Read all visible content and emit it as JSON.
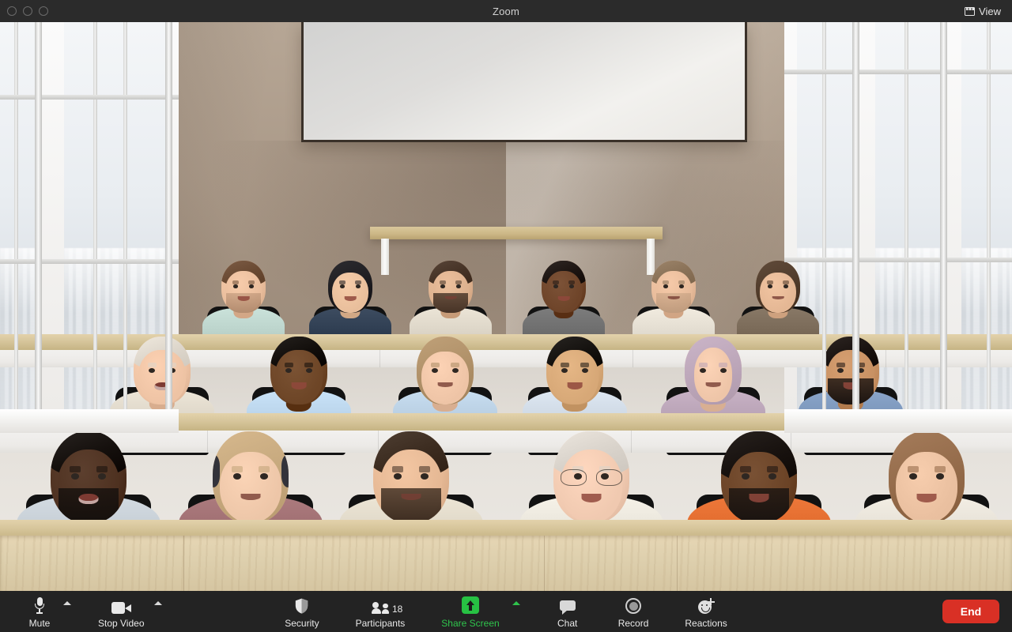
{
  "window": {
    "title": "Zoom",
    "traffic_lights": [
      "close",
      "minimize",
      "maximize"
    ]
  },
  "header": {
    "view_button_label": "View",
    "view_icon": "layout-grid-icon"
  },
  "meeting": {
    "participant_count": "18",
    "virtual_background": "conference-room-with-tiered-desks-and-city-windows",
    "layout": "immersive-view"
  },
  "toolbar": {
    "background_color": "#232323",
    "items": [
      {
        "id": "mute",
        "label": "Mute",
        "icon": "microphone-icon",
        "caret": true,
        "accent": false
      },
      {
        "id": "stop-video",
        "label": "Stop Video",
        "icon": "video-camera-icon",
        "caret": true,
        "accent": false
      },
      {
        "id": "security",
        "label": "Security",
        "icon": "shield-icon",
        "caret": false,
        "accent": false
      },
      {
        "id": "participants",
        "label": "Participants",
        "icon": "people-icon",
        "caret": false,
        "accent": false,
        "badge": "18"
      },
      {
        "id": "share-screen",
        "label": "Share Screen",
        "icon": "share-screen-icon",
        "caret": true,
        "accent": true
      },
      {
        "id": "chat",
        "label": "Chat",
        "icon": "chat-bubble-icon",
        "caret": false,
        "accent": false
      },
      {
        "id": "record",
        "label": "Record",
        "icon": "record-circle-icon",
        "caret": false,
        "accent": false
      },
      {
        "id": "reactions",
        "label": "Reactions",
        "icon": "smiley-plus-icon",
        "caret": false,
        "accent": false
      }
    ],
    "end_button_label": "End",
    "end_button_color": "#d93025",
    "accent_color": "#2fc44c"
  },
  "participants": [
    {
      "row": 3,
      "seat": 1,
      "skin": "#e9bd9c",
      "hair": "#6a4a33",
      "hair_style": "short",
      "top": "#bcd4cc",
      "facial_hair": "stubble",
      "expression": "smile"
    },
    {
      "row": 3,
      "seat": 2,
      "skin": "#e8be9b",
      "hair": "#17161a",
      "hair_style": "long",
      "top": "#2f3e52",
      "facial_hair": "none",
      "expression": "smile"
    },
    {
      "row": 3,
      "seat": 3,
      "skin": "#ddb18e",
      "hair": "#463326",
      "hair_style": "short",
      "top": "#ddd6c8",
      "facial_hair": "beard",
      "expression": "neutral"
    },
    {
      "row": 3,
      "seat": 4,
      "skin": "#6e4429",
      "hair": "#1d1512",
      "hair_style": "short",
      "top": "#6e6e6e",
      "facial_hair": "none",
      "expression": "smile"
    },
    {
      "row": 3,
      "seat": 5,
      "skin": "#e7bb9a",
      "hair": "#8a7258",
      "hair_style": "short",
      "top": "#e3ddd1",
      "facial_hair": "stubble",
      "expression": "neutral"
    },
    {
      "row": 3,
      "seat": 6,
      "skin": "#e4b794",
      "hair": "#4a3524",
      "hair_style": "long",
      "top": "#7a6a58",
      "facial_hair": "none",
      "expression": "neutral"
    },
    {
      "row": 2,
      "seat": 1,
      "skin": "#eec3a4",
      "hair": "#ddd6cb",
      "hair_style": "short",
      "top": "#ded7c9",
      "facial_hair": "none",
      "expression": "laugh"
    },
    {
      "row": 2,
      "seat": 2,
      "skin": "#6d4526",
      "hair": "#120e0b",
      "hair_style": "short",
      "top": "#bad4ea",
      "facial_hair": "none",
      "expression": "smile"
    },
    {
      "row": 2,
      "seat": 3,
      "skin": "#eec4a6",
      "hair": "#a98a62",
      "hair_style": "long",
      "top": "#b9cfe2",
      "facial_hair": "none",
      "expression": "neutral"
    },
    {
      "row": 2,
      "seat": 4,
      "skin": "#d7a877",
      "hair": "#15120f",
      "hair_style": "short",
      "top": "#cfd9e4",
      "facial_hair": "none",
      "expression": "smile"
    },
    {
      "row": 2,
      "seat": 5,
      "skin": "#eec5a8",
      "hair": "#b9a3b6",
      "hair_style": "hijab",
      "top": "#b9a3b6",
      "facial_hair": "none",
      "expression": "neutral"
    },
    {
      "row": 2,
      "seat": 6,
      "skin": "#c89163",
      "hair": "#1a1310",
      "hair_style": "short",
      "top": "#7b96bb",
      "facial_hair": "beard",
      "expression": "smile"
    },
    {
      "row": 1,
      "seat": 1,
      "skin": "#4e3120",
      "hair": "#15100d",
      "hair_style": "short",
      "top": "#c5cdd4",
      "facial_hair": "beard",
      "expression": "laugh"
    },
    {
      "row": 1,
      "seat": 2,
      "skin": "#edc6a8",
      "hair": "#c0a277",
      "hair_style": "long",
      "top": "#9e6d70",
      "facial_hair": "none",
      "expression": "neutral",
      "accessory": "headphones"
    },
    {
      "row": 1,
      "seat": 3,
      "skin": "#e5b894",
      "hair": "#3c2c20",
      "hair_style": "short",
      "top": "#ded7c7",
      "facial_hair": "beard",
      "expression": "neutral"
    },
    {
      "row": 1,
      "seat": 4,
      "skin": "#f0c9b0",
      "hair": "#d9d3cb",
      "hair_style": "short",
      "top": "#e8e4da",
      "facial_hair": "none",
      "expression": "smile",
      "accessory": "glasses"
    },
    {
      "row": 1,
      "seat": 5,
      "skin": "#6b4326",
      "hair": "#191310",
      "hair_style": "afro",
      "top": "#e06a2c",
      "facial_hair": "beard",
      "expression": "smile"
    },
    {
      "row": 1,
      "seat": 6,
      "skin": "#e9bf9f",
      "hair": "#8e6544",
      "hair_style": "long",
      "top": "#e5e0d6",
      "facial_hair": "none",
      "expression": "smile"
    }
  ]
}
